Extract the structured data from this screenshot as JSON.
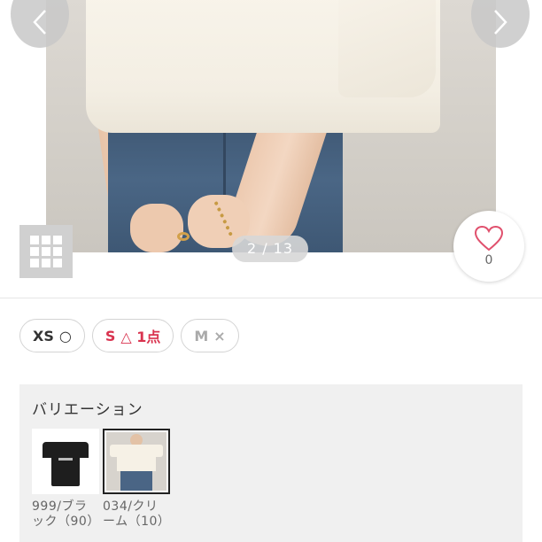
{
  "gallery": {
    "counter": "2 / 13",
    "prev_icon": "chevron-left-icon",
    "next_icon": "chevron-right-icon",
    "grid_icon": "grid-view-icon"
  },
  "favorite": {
    "icon": "heart-icon",
    "count": "0",
    "color": "#e0506d"
  },
  "sizes": [
    {
      "label": "XS",
      "stock": "○",
      "state": "available"
    },
    {
      "label": "S",
      "stock": "△ 1点",
      "state": "low"
    },
    {
      "label": "M",
      "stock": "×",
      "state": "soldout"
    }
  ],
  "variation": {
    "title": "バリエーション",
    "items": [
      {
        "caption": "999/ブラック（90）",
        "selected": false
      },
      {
        "caption": "034/クリーム（10）",
        "selected": true
      }
    ]
  },
  "colors": {
    "accent": "#d9334f",
    "disabled": "#aaaaaa",
    "panel_bg": "#f0f0f0"
  }
}
